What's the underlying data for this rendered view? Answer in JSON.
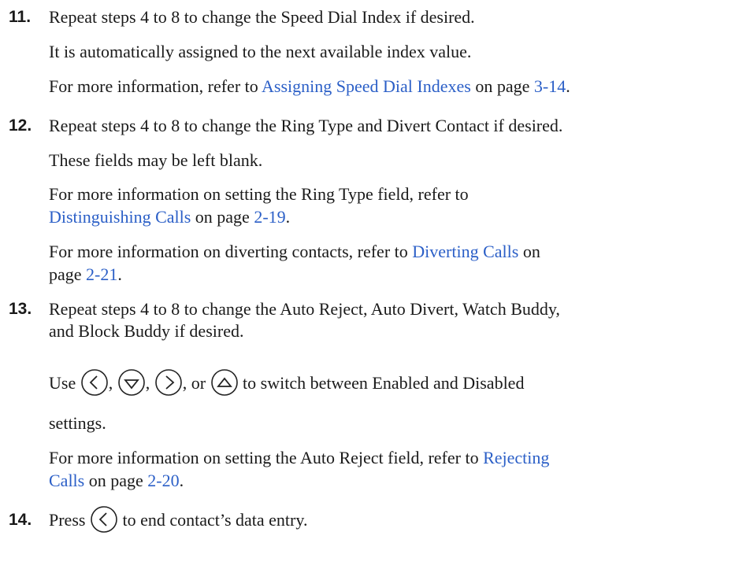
{
  "steps": [
    {
      "number": "11.",
      "text": "Repeat steps 4 to 8 to change the Speed Dial Index if desired.",
      "note": "It is automatically assigned to the next available index value.",
      "ref": {
        "prefix": "For more information, refer to ",
        "link": "Assigning Speed Dial Indexes",
        "mid": " on page ",
        "page": "3-14",
        "suffix": "."
      }
    },
    {
      "number": "12.",
      "text": "Repeat steps 4 to 8 to change the Ring Type and Divert Contact if desired.",
      "note": "These fields may be left blank.",
      "ref1": {
        "line1": "For more information on setting the Ring Type field, refer to",
        "link": "Distinguishing Calls",
        "mid": " on page ",
        "page": "2-19",
        "suffix": "."
      },
      "ref2": {
        "prefix": "For more information on diverting contacts, refer to ",
        "link": "Diverting Calls",
        "mid": " on",
        "line2_prefix": "page ",
        "page": "2-21",
        "suffix": "."
      }
    },
    {
      "number": "13.",
      "text_line1": "Repeat steps 4 to 8 to change the Auto Reject, Auto Divert, Watch Buddy,",
      "text_line2": "and Block Buddy if desired.",
      "use": {
        "prefix": "Use",
        "sep1": ",",
        "sep2": ",",
        "sep3": ", or",
        "suffix": "to switch between Enabled and Disabled",
        "line2": "settings."
      },
      "ref": {
        "prefix": "For more information on setting the Auto Reject field, refer to ",
        "link_line1": "Rejecting",
        "link_line2": "Calls",
        "mid": " on page ",
        "page": "2-20",
        "suffix": "."
      }
    },
    {
      "number": "14.",
      "prefix": "Press",
      "suffix": "to end contact’s data entry."
    }
  ],
  "icons": {
    "left_key": "left-arrow-key-icon",
    "down_key": "down-arrow-key-icon",
    "right_key": "right-arrow-key-icon",
    "up_key": "up-arrow-key-icon"
  },
  "colors": {
    "link": "#2b5fc7",
    "text": "#1a1a1a"
  }
}
